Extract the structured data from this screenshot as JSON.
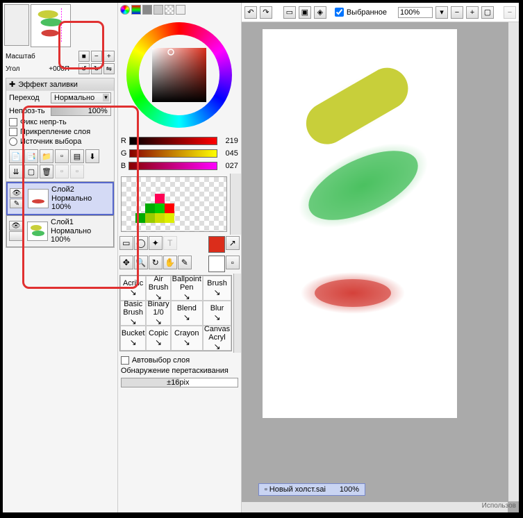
{
  "nav": {
    "scale_label": "Масштаб",
    "angle_label": "Угол",
    "angle_value": "+000Я"
  },
  "fill": {
    "title": "Эффект заливки",
    "blend_label": "Переход",
    "blend_value": "Нормально",
    "opacity_label": "Непроз-ть",
    "opacity_value": "100%",
    "fix_opacity": "Фикс непр-ть",
    "clip_layer": "Прикрепление слоя",
    "sel_source": "Источник выбора"
  },
  "layers": [
    {
      "name": "Слой2",
      "mode": "Нормально",
      "opacity": "100%",
      "active": true
    },
    {
      "name": "Слой1",
      "mode": "Нормально",
      "opacity": "100%",
      "active": false
    }
  ],
  "rgb": {
    "r": "219",
    "g": "045",
    "b": "027"
  },
  "swatches": {
    "row1": [
      "",
      "",
      "#f05",
      "",
      ""
    ],
    "row2": [
      "",
      "#0a0",
      "#0c0",
      "#f00",
      ""
    ],
    "row3": [
      "#0a0",
      "#9c0",
      "#cd0",
      "#de0",
      ""
    ]
  },
  "brushes": [
    [
      "Acrilic",
      ""
    ],
    [
      "Air",
      "Brush"
    ],
    [
      "Ballpoint",
      "Pen"
    ],
    [
      "Brush",
      ""
    ],
    [
      "Basic",
      "Brush"
    ],
    [
      "Binary",
      "1/0"
    ],
    [
      "Blend",
      ""
    ],
    [
      "Blur",
      ""
    ],
    [
      "Bucket",
      ""
    ],
    [
      "Copic",
      ""
    ],
    [
      "Crayon",
      ""
    ],
    [
      "Canvas",
      "Acryl"
    ]
  ],
  "auto_select": "Автовыбор слоя",
  "drag_detect": "Обнаружение перетаскивания",
  "drag_px": "±16pix",
  "toolbar": {
    "selected": "Выбранное",
    "zoom": "100%"
  },
  "file": {
    "name": "Новый холст.sai",
    "zoom": "100%"
  },
  "status": "Использов",
  "current_color": "#db2d1b"
}
